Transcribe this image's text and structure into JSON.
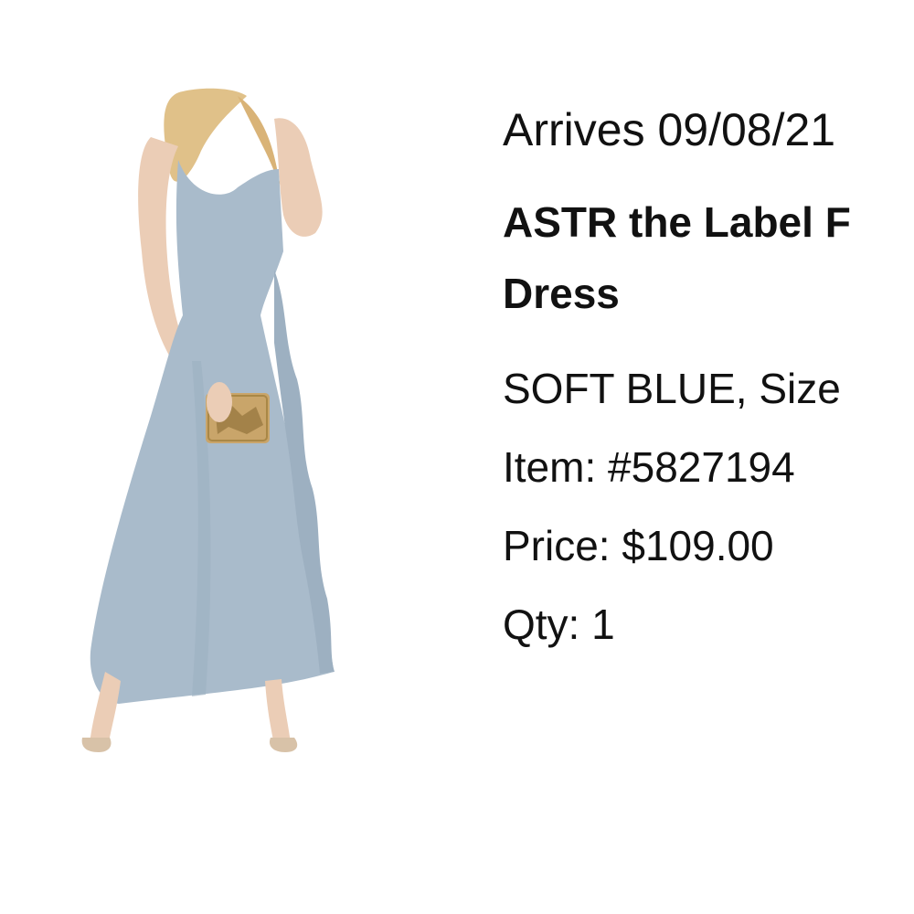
{
  "order_item": {
    "arrives": "Arrives 09/08/21",
    "title_line1": "ASTR the Label F",
    "title_line2": "Dress",
    "color_size": "SOFT BLUE, Size",
    "item_number": "Item: #5827194",
    "price": "Price: $109.00",
    "qty": "Qty: 1"
  },
  "image": {
    "icon": "product-photo",
    "dress_color": "#A9BBCB",
    "clutch_color": "#C9A56A",
    "hair_color": "#E0C189",
    "skin_color": "#EBCDB6"
  }
}
